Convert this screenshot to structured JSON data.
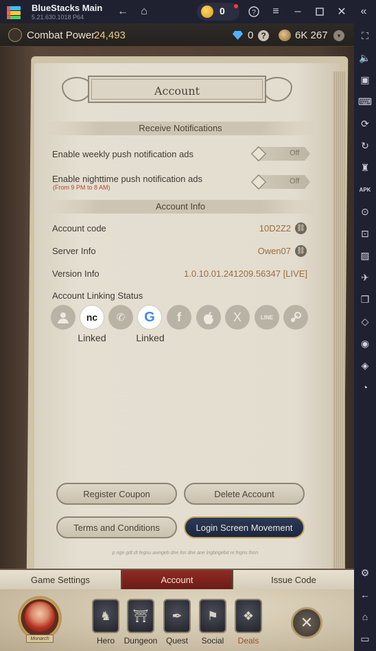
{
  "emulator": {
    "title": "BlueStacks Main",
    "version": "5.21.630.1018  P64",
    "coins": "0",
    "icons": [
      "back-arrow-icon",
      "home-icon",
      "help-icon",
      "menu-icon",
      "minimize-icon",
      "maximize-icon",
      "collapse-icon"
    ]
  },
  "sidebar": {
    "icons": [
      "fullscreen-icon",
      "volume-icon",
      "screen-record-icon",
      "keyboard-icon",
      "macro-play-icon",
      "rotate-icon",
      "gamepad-icon",
      "apk-icon",
      "screenshot-icon",
      "resize-icon",
      "media-icon",
      "airplane-icon",
      "multi-instance-icon",
      "eco-mode-icon",
      "location-icon",
      "layers-icon",
      "performance-icon",
      "settings-icon",
      "back-icon",
      "home-icon",
      "recents-icon"
    ],
    "apk_label": "APK"
  },
  "topbar": {
    "combat_power_label": "Combat Power",
    "combat_power_value": "24,493",
    "gems": "0",
    "help": "?",
    "shells": "6K 267",
    "more": "▾"
  },
  "page": {
    "title": "Account",
    "notifications_header": "Receive Notifications",
    "weekly_label": "Enable weekly push notification ads",
    "weekly_state": "Off",
    "nighttime_label": "Enable nighttime push notification ads",
    "nighttime_sub": "(From 9 PM to 8 AM)",
    "nighttime_state": "Off",
    "account_info_header": "Account Info",
    "account_code_label": "Account code",
    "account_code_value": "10D2Z2",
    "server_info_label": "Server Info",
    "server_info_value": "Owen07",
    "version_info_label": "Version Info",
    "version_info_value": "1.0.10.01.241209.56347 [LIVE]",
    "linking_label": "Account Linking Status",
    "linking": [
      {
        "provider": "guest",
        "icon": "person-icon",
        "linked": false
      },
      {
        "provider": "nc",
        "icon": "nc-logo-icon",
        "linked": true,
        "label": "Linked",
        "text": "nc"
      },
      {
        "provider": "phone",
        "icon": "phone-icon",
        "linked": false
      },
      {
        "provider": "google",
        "icon": "google-icon",
        "linked": true,
        "label": "Linked",
        "text": "G"
      },
      {
        "provider": "facebook",
        "icon": "facebook-icon",
        "linked": false,
        "text": "f"
      },
      {
        "provider": "apple",
        "icon": "apple-icon",
        "linked": false
      },
      {
        "provider": "x",
        "icon": "x-icon",
        "linked": false,
        "text": "X"
      },
      {
        "provider": "line",
        "icon": "line-icon",
        "linked": false,
        "text": "LINE"
      },
      {
        "provider": "steam",
        "icon": "steam-icon",
        "linked": false
      }
    ],
    "register_coupon": "Register Coupon",
    "delete_account": "Delete Account",
    "terms": "Terms and Conditions",
    "login_screen": "Login Screen Movement",
    "footer_script": "p nge gdt dt fegnu awngeb dne lnn dne ane lngbngebd re fngns fnnn"
  },
  "tabs": {
    "game_settings": "Game Settings",
    "account": "Account",
    "issue_code": "Issue Code"
  },
  "bottomnav": {
    "avatar_plate": "Monarch",
    "hero": "Hero",
    "dungeon": "Dungeon",
    "quest": "Quest",
    "social": "Social",
    "deals": "Deals"
  },
  "colors": {
    "accent_red": "#8f2b24",
    "link_value": "#9a6d3a",
    "primary_button": "#1c2740"
  }
}
